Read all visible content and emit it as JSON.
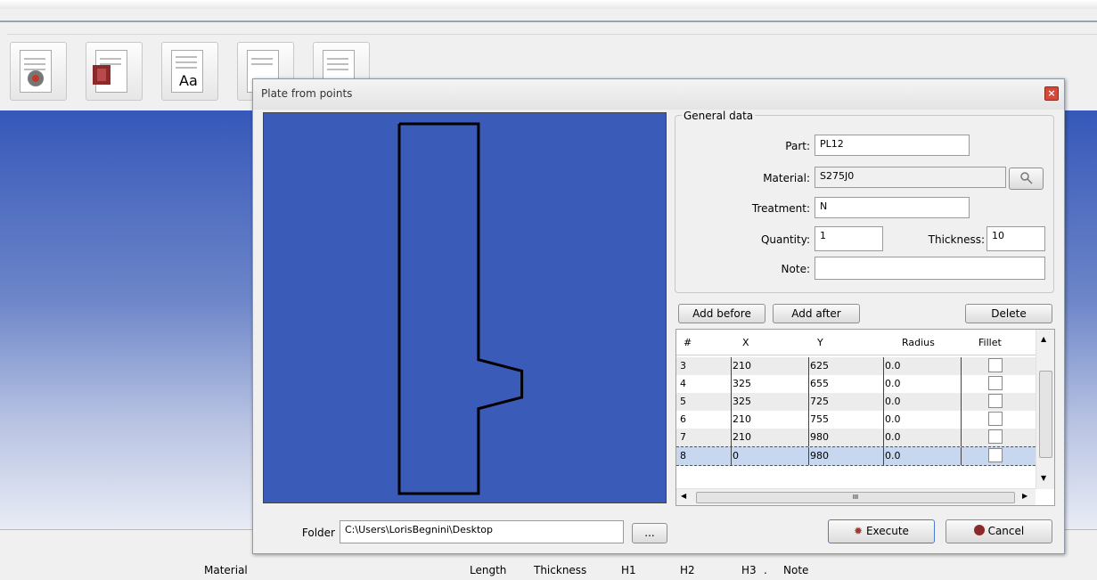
{
  "toolbar": {
    "buttons": [
      {
        "icon": "settings-document-icon"
      },
      {
        "icon": "beam-document-icon"
      },
      {
        "icon": "font-document-icon",
        "text": "Aa"
      },
      {
        "icon": "tools-document-icon"
      },
      {
        "icon": "list-document-icon"
      }
    ]
  },
  "dialog": {
    "title": "Plate from points",
    "general": {
      "legend": "General data",
      "part_label": "Part:",
      "part_value": "PL12",
      "material_label": "Material:",
      "material_value": "S275J0",
      "treatment_label": "Treatment:",
      "treatment_value": "N",
      "quantity_label": "Quantity:",
      "quantity_value": "1",
      "thickness_label": "Thickness:",
      "thickness_value": "10",
      "note_label": "Note:",
      "note_value": ""
    },
    "buttons": {
      "add_before": "Add before",
      "add_after": "Add after",
      "delete": "Delete",
      "execute": "Execute",
      "cancel": "Cancel",
      "browse": "..."
    },
    "grid": {
      "headers": [
        "#",
        "X",
        "Y",
        "Radius",
        "Fillet"
      ],
      "rows": [
        {
          "n": "3",
          "x": "210",
          "y": "625",
          "r": "0.0",
          "fillet": false
        },
        {
          "n": "4",
          "x": "325",
          "y": "655",
          "r": "0.0",
          "fillet": false
        },
        {
          "n": "5",
          "x": "325",
          "y": "725",
          "r": "0.0",
          "fillet": false
        },
        {
          "n": "6",
          "x": "210",
          "y": "755",
          "r": "0.0",
          "fillet": false
        },
        {
          "n": "7",
          "x": "210",
          "y": "980",
          "r": "0.0",
          "fillet": false
        },
        {
          "n": "8",
          "x": "0",
          "y": "980",
          "r": "0.0",
          "fillet": false
        }
      ],
      "selected_row": "8",
      "scroll_glyph": "III"
    },
    "folder_label": "Folder",
    "folder_value": "C:\\Users\\LorisBegnini\\Desktop",
    "plate_points": [
      [
        0,
        0
      ],
      [
        210,
        0
      ],
      [
        210,
        625
      ],
      [
        325,
        655
      ],
      [
        325,
        725
      ],
      [
        210,
        755
      ],
      [
        210,
        980
      ],
      [
        0,
        980
      ]
    ]
  },
  "columns": [
    "Material",
    "Length",
    "Thickness",
    "H1",
    "H2",
    "H3",
    ".",
    "Note"
  ],
  "colors": {
    "canvas": "#3a5bb8",
    "selection": "#c7d7f0",
    "close": "#d9473a"
  }
}
